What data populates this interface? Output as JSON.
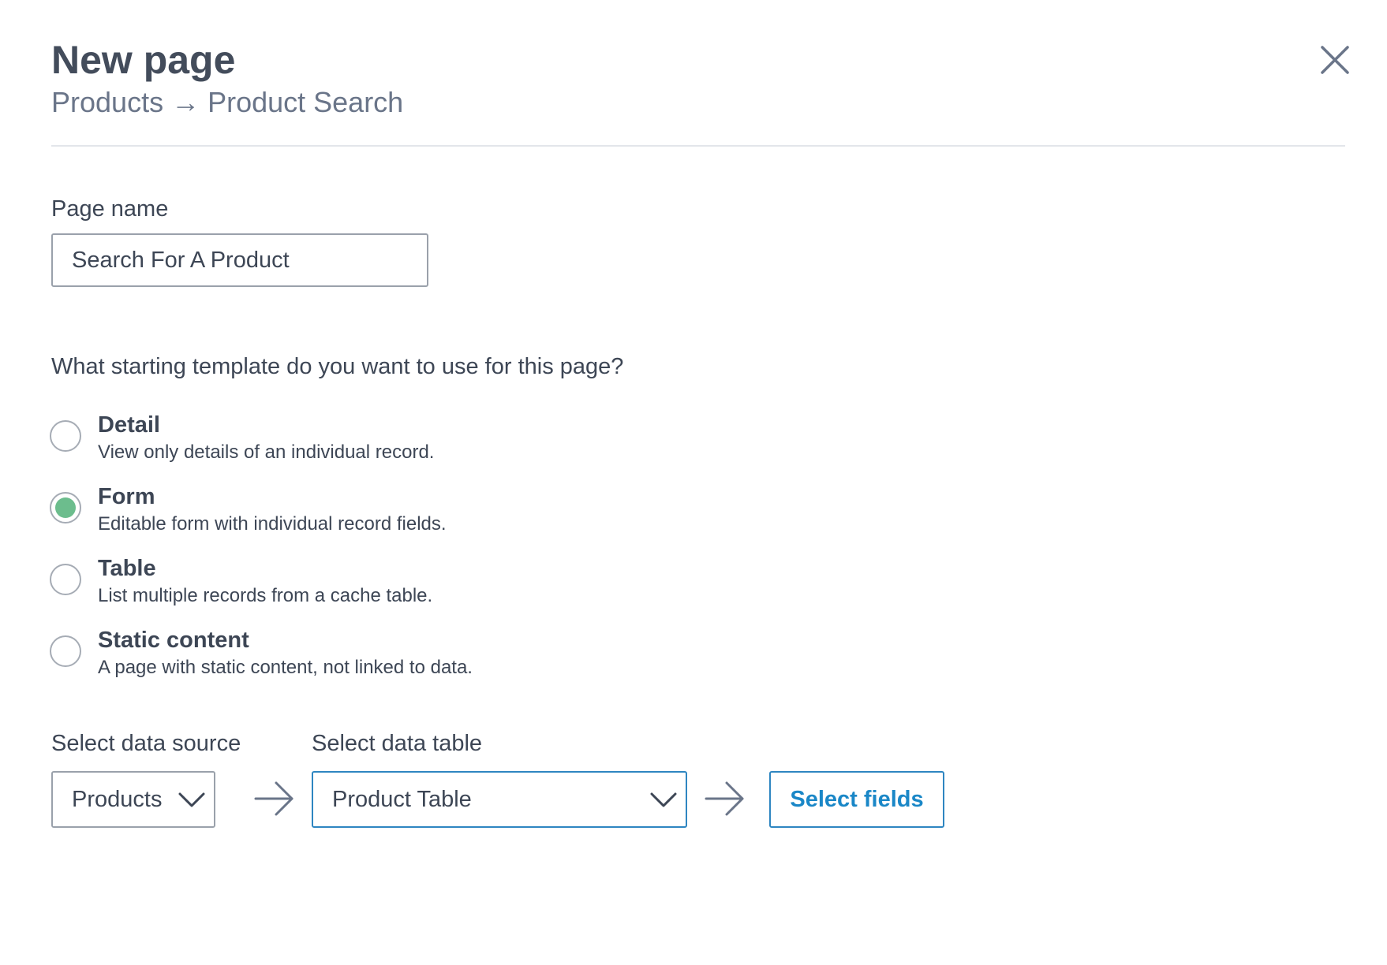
{
  "header": {
    "title": "New page",
    "breadcrumb": "Products → Product Search"
  },
  "page_name": {
    "label": "Page name",
    "value": "Search For A Product"
  },
  "template": {
    "question": "What starting template do you want to use for this page?",
    "selected": "Form",
    "options": [
      {
        "title": "Detail",
        "description": "View only details of an individual record.",
        "checked": false
      },
      {
        "title": "Form",
        "description": "Editable form with individual record fields.",
        "checked": true
      },
      {
        "title": "Table",
        "description": "List multiple records from a cache table.",
        "checked": false
      },
      {
        "title": "Static content",
        "description": "A page with static content, not linked to data.",
        "checked": false
      }
    ]
  },
  "data_source": {
    "label": "Select data source",
    "value": "Products"
  },
  "data_table": {
    "label": "Select data table",
    "value": "Product Table"
  },
  "actions": {
    "select_fields_label": "Select fields"
  },
  "colors": {
    "text": "#3d4655",
    "muted": "#6a7589",
    "accent": "#2e86c1",
    "radio_selected": "#6cbd8d",
    "border": "#9aa1ab"
  },
  "icons": {
    "close": "close-icon",
    "dropdown": "chevron-down-icon",
    "flow": "arrow-right-icon"
  }
}
